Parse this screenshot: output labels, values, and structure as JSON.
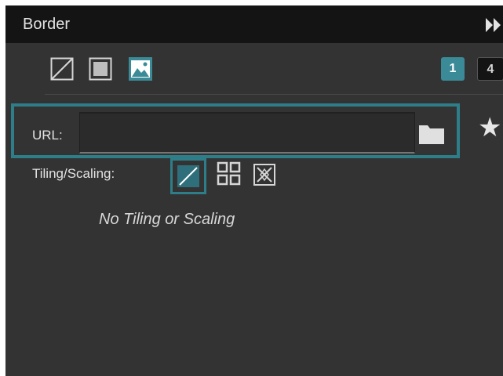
{
  "panel": {
    "title": "Border",
    "collapse_icon": "double-chevron-right-icon"
  },
  "border_type_buttons": [
    {
      "id": "none",
      "icon": "no-border-icon",
      "selected": false
    },
    {
      "id": "solid",
      "icon": "solid-border-icon",
      "selected": false
    },
    {
      "id": "image",
      "icon": "image-border-icon",
      "selected": true
    }
  ],
  "pages": {
    "items": [
      "1",
      "4"
    ],
    "selected": "1"
  },
  "url": {
    "label": "URL:",
    "value": "",
    "browse_icon": "folder-icon",
    "favorite_icon": "star-icon"
  },
  "tiling": {
    "label": "Tiling/Scaling:",
    "options": [
      {
        "id": "none",
        "icon": "no-tiling-icon",
        "selected": true
      },
      {
        "id": "tile",
        "icon": "tile-grid-icon",
        "selected": false
      },
      {
        "id": "scale",
        "icon": "scale-icon",
        "selected": false
      }
    ],
    "status": "No Tiling or Scaling"
  },
  "colors": {
    "accent": "#2d7e88",
    "panel_bg": "#333333",
    "header_bg": "#141414",
    "text": "#e3e3e3"
  }
}
